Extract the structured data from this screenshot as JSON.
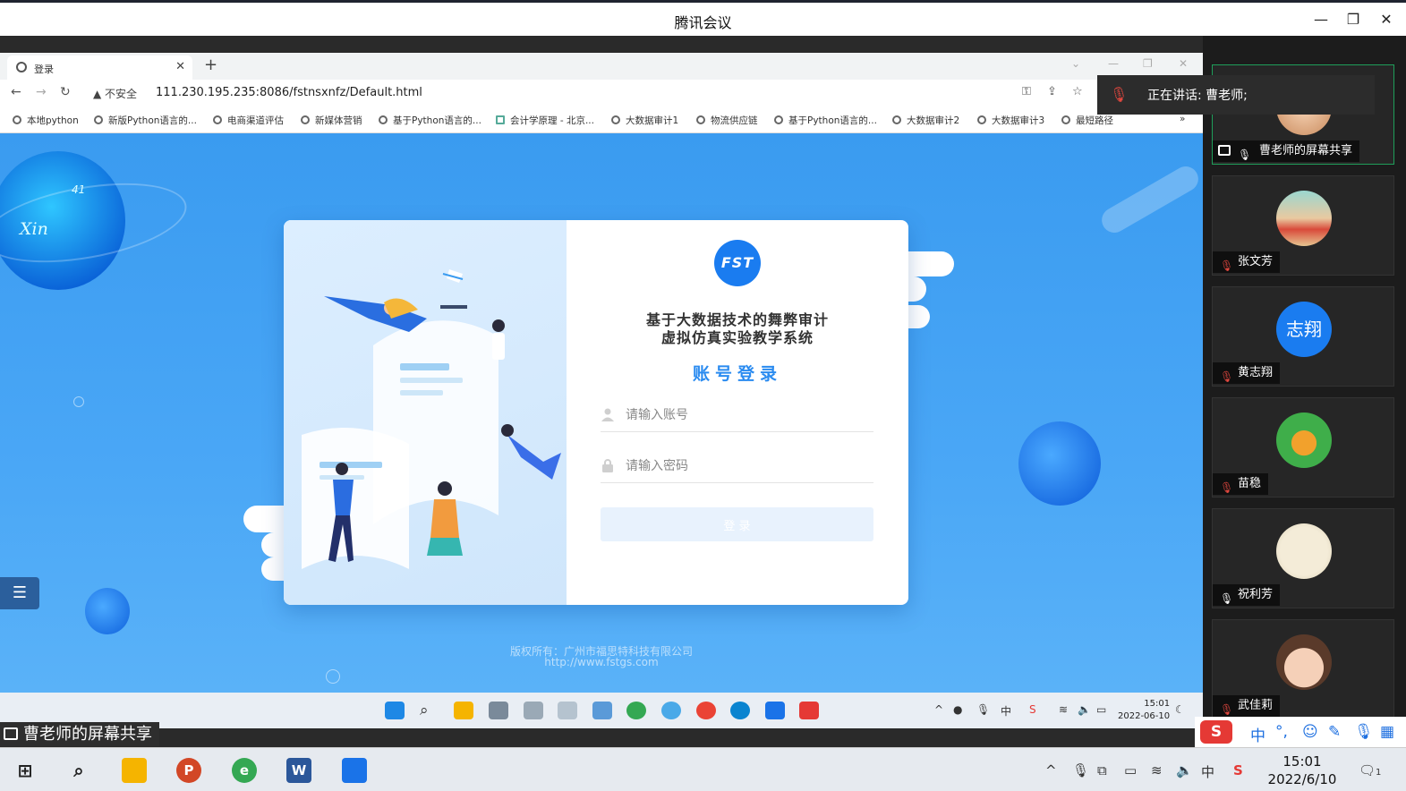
{
  "app": {
    "title": "腾讯会议",
    "minimize": "—",
    "restore": "❐",
    "close": "✕"
  },
  "browser": {
    "tab_title": "登录",
    "tab_close": "✕",
    "new_tab": "+",
    "insecure_label": "不安全",
    "url": "111.230.195.235:8086/fstnsxnfz/Default.html",
    "bookmarks": [
      "本地python",
      "新版Python语言的...",
      "电商渠道评估",
      "新媒体营销",
      "基于Python语言的...",
      "会计学原理 - 北京...",
      "大数据审计1",
      "物流供应链",
      "基于Python语言的...",
      "大数据审计2",
      "大数据审计3",
      "最短路径"
    ],
    "more_bookmarks": "»"
  },
  "login": {
    "logo_text": "FST",
    "system_title_line1": "基于大数据技术的舞弊审计",
    "system_title_line2": "虚拟仿真实验教学系统",
    "heading": "账号登录",
    "account_placeholder": "请输入账号",
    "password_placeholder": "请输入密码",
    "login_button": "登 录",
    "copyright_line1": "版权所有：广州市福思特科技有限公司",
    "copyright_line2": "http://www.fstgs.com"
  },
  "planet_text": "Xin",
  "planet_text2": "41",
  "remote_taskbar": {
    "time": "15:01",
    "date": "2022-06-10",
    "ime": "中"
  },
  "share_label": "曹老师的屏幕共享",
  "speaker_banner": "正在讲话: 曹老师;",
  "participants": [
    {
      "name": "曹老师的屏幕共享",
      "mic": "on",
      "avatar": "photo",
      "active": true
    },
    {
      "name": "张文芳",
      "mic": "muted",
      "avatar": "photo"
    },
    {
      "name": "黄志翔",
      "mic": "muted",
      "avatar": "text",
      "avatar_text": "志翔"
    },
    {
      "name": "苗稳",
      "mic": "muted",
      "avatar": "giraffe"
    },
    {
      "name": "祝利芳",
      "mic": "on",
      "avatar": "photo"
    },
    {
      "name": "武佳莉",
      "mic": "muted",
      "avatar": "photo"
    }
  ],
  "host_taskbar": {
    "time": "15:01",
    "date": "2022/6/10",
    "ime": "中",
    "notification_count": "1"
  },
  "ime_bar": {
    "lang": "中",
    "punct": "°,"
  },
  "colors": {
    "page_blue": "#3a9bf0",
    "accent": "#2a8bf0",
    "logo_blue": "#1a7cf0",
    "active_tile_border": "#1f9e5a",
    "muted_red": "#e0473e"
  }
}
